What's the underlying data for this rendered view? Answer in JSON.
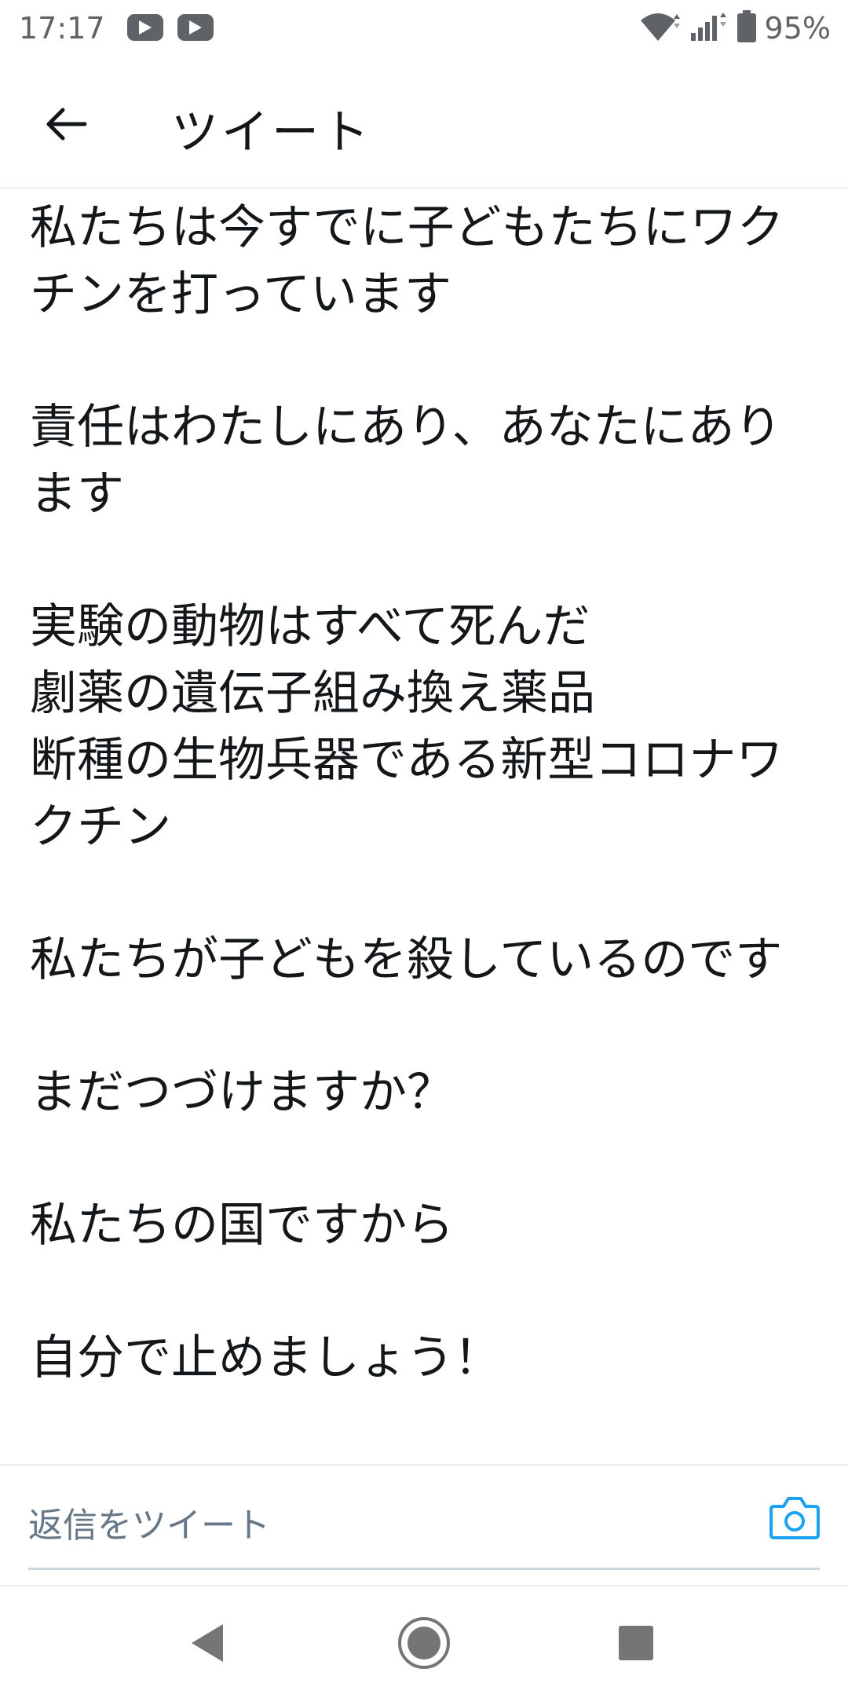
{
  "status_bar": {
    "time": "17:17",
    "notification_icons": [
      "youtube-icon",
      "youtube-icon"
    ],
    "battery_percent": "95%"
  },
  "header": {
    "title": "ツイート"
  },
  "tweet": {
    "paragraphs": [
      "私たちは今すでに子どもたちにワクチンを打っています",
      "責任はわたしにあり、あなたにあります",
      "実験の動物はすべて死んだ\n劇薬の遺伝子組み換え薬品\n断種の生物兵器である新型コロナワクチン",
      "私たちが子どもを殺しているのです",
      "まだつづけますか？",
      "私たちの国ですから",
      "自分で止めましょう！"
    ]
  },
  "reply": {
    "placeholder": "返信をツイート"
  },
  "colors": {
    "accent": "#1da1f2",
    "text": "#14171a",
    "muted": "#657786",
    "divider": "#e6ecf0"
  }
}
